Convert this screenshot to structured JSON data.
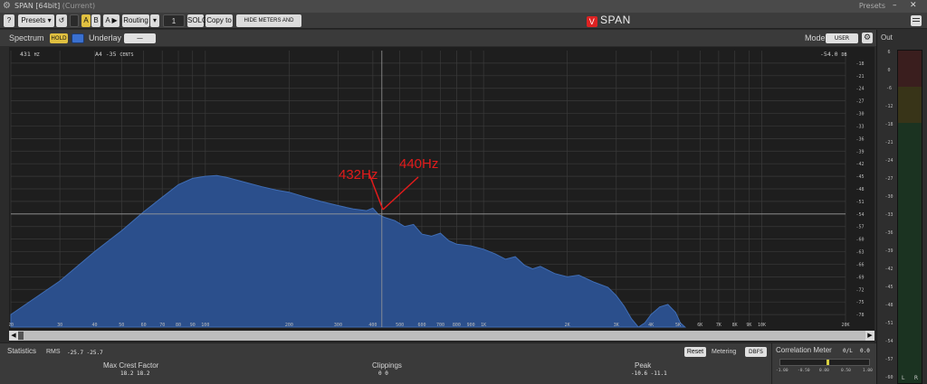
{
  "window": {
    "title": "SPAN [64bit]",
    "title_state": "(Current)",
    "presets_label": "Presets",
    "minimize": "–",
    "close": "✕"
  },
  "toolbar": {
    "help": "?",
    "presets": "Presets",
    "ab_a": "A",
    "ab_b": "B",
    "a_to_b": "A ▶ B",
    "routing": "Routing",
    "routing_value": "1",
    "solo": "SOLO",
    "copy_to": "Copy to",
    "hide_meters": "HIDE METERS AND STATS",
    "brand": "SPAN"
  },
  "spectrum_header": {
    "title": "Spectrum",
    "hold": "HOLD",
    "underlay_label": "Underlay",
    "underlay_value": "—",
    "mode_label": "Mode",
    "mode_value": "USER"
  },
  "readout": {
    "freq": "431",
    "freq_unit": "HZ",
    "note": "A4 -35",
    "note_unit": "CENTS",
    "level": "-54.0",
    "level_unit": "DB"
  },
  "annotations": [
    {
      "text": "432Hz",
      "color": "#e21b1b"
    },
    {
      "text": "440Hz",
      "color": "#e21b1b"
    }
  ],
  "colors": {
    "spectrum_fill": "#2b4f8c",
    "spectrum_edge": "#3f6db5",
    "grid": "#3a3a3a",
    "annotation": "#e21b1b",
    "hold": "#e0c040"
  },
  "chart_data": {
    "type": "area",
    "x_scale": "log",
    "xlim": [
      20,
      20000
    ],
    "ylim": [
      -81,
      -15
    ],
    "x_ticks": [
      {
        "v": 20,
        "label": "20"
      },
      {
        "v": 30,
        "label": "30"
      },
      {
        "v": 40,
        "label": "40"
      },
      {
        "v": 50,
        "label": "50"
      },
      {
        "v": 60,
        "label": "60"
      },
      {
        "v": 70,
        "label": "70"
      },
      {
        "v": 80,
        "label": "80"
      },
      {
        "v": 90,
        "label": "90"
      },
      {
        "v": 100,
        "label": "100"
      },
      {
        "v": 200,
        "label": "200"
      },
      {
        "v": 300,
        "label": "300"
      },
      {
        "v": 400,
        "label": "400"
      },
      {
        "v": 500,
        "label": "500"
      },
      {
        "v": 600,
        "label": "600"
      },
      {
        "v": 700,
        "label": "700"
      },
      {
        "v": 800,
        "label": "800"
      },
      {
        "v": 900,
        "label": "900"
      },
      {
        "v": 1000,
        "label": "1K"
      },
      {
        "v": 2000,
        "label": "2K"
      },
      {
        "v": 3000,
        "label": "3K"
      },
      {
        "v": 4000,
        "label": "4K"
      },
      {
        "v": 5000,
        "label": "5K"
      },
      {
        "v": 6000,
        "label": "6K"
      },
      {
        "v": 7000,
        "label": "7K"
      },
      {
        "v": 8000,
        "label": "8K"
      },
      {
        "v": 9000,
        "label": "9K"
      },
      {
        "v": 10000,
        "label": "10K"
      },
      {
        "v": 20000,
        "label": "20K"
      }
    ],
    "y_ticks": [
      -18,
      -21,
      -24,
      -27,
      -30,
      -33,
      -36,
      -39,
      -42,
      -45,
      -48,
      -51,
      -54,
      -57,
      -60,
      -63,
      -66,
      -69,
      -72,
      -75,
      -78
    ],
    "cursor": {
      "freq": 431,
      "level": -54.0
    },
    "points": [
      [
        20,
        -78
      ],
      [
        30,
        -70
      ],
      [
        40,
        -63
      ],
      [
        50,
        -58
      ],
      [
        60,
        -53.5
      ],
      [
        70,
        -50
      ],
      [
        80,
        -47
      ],
      [
        90,
        -45.5
      ],
      [
        100,
        -45
      ],
      [
        110,
        -44.8
      ],
      [
        120,
        -45.3
      ],
      [
        140,
        -46.5
      ],
      [
        160,
        -47.5
      ],
      [
        180,
        -48.3
      ],
      [
        200,
        -48.8
      ],
      [
        230,
        -50
      ],
      [
        260,
        -51
      ],
      [
        300,
        -52
      ],
      [
        340,
        -52.8
      ],
      [
        380,
        -53.2
      ],
      [
        400,
        -52.6
      ],
      [
        420,
        -54.2
      ],
      [
        440,
        -54.8
      ],
      [
        480,
        -55.6
      ],
      [
        520,
        -57
      ],
      [
        560,
        -56.5
      ],
      [
        600,
        -58.8
      ],
      [
        650,
        -59.3
      ],
      [
        700,
        -58.6
      ],
      [
        750,
        -60.4
      ],
      [
        800,
        -61.2
      ],
      [
        900,
        -61.6
      ],
      [
        1000,
        -62.4
      ],
      [
        1100,
        -63.5
      ],
      [
        1200,
        -64.8
      ],
      [
        1300,
        -64.2
      ],
      [
        1400,
        -66.2
      ],
      [
        1500,
        -67.1
      ],
      [
        1600,
        -66.5
      ],
      [
        1800,
        -68.2
      ],
      [
        2000,
        -69
      ],
      [
        2200,
        -68.6
      ],
      [
        2500,
        -70.3
      ],
      [
        2800,
        -71.5
      ],
      [
        3000,
        -73.5
      ],
      [
        3200,
        -76
      ],
      [
        3400,
        -79
      ],
      [
        3600,
        -81
      ],
      [
        3800,
        -80
      ],
      [
        4000,
        -78
      ],
      [
        4300,
        -76.2
      ],
      [
        4600,
        -75.6
      ],
      [
        4900,
        -77.5
      ],
      [
        5100,
        -80
      ],
      [
        5300,
        -81
      ]
    ]
  },
  "statistics": {
    "title": "Statistics",
    "rms_label": "RMS",
    "rms_values": "-25.7  -25.7",
    "max_crest_label": "Max Crest Factor",
    "max_crest_values": "18.2   18.2",
    "clippings_label": "Clippings",
    "clippings_values": "0    0",
    "peak_label": "Peak",
    "peak_values": "-10.6  -11.1",
    "reset": "Reset",
    "metering_label": "Metering",
    "metering_value": "DBFS"
  },
  "correlation": {
    "title": "Correlation Meter",
    "mode": "0/L",
    "value": "0.0",
    "value_fraction": 0.52,
    "ticks": [
      "-1.00",
      "-0.50",
      "0.00",
      "0.50",
      "1.00"
    ]
  },
  "out_meter": {
    "title": "Out",
    "scale": [
      "6",
      "0",
      "-6",
      "-12",
      "-18",
      "-21",
      "-24",
      "-27",
      "-30",
      "-33",
      "-36",
      "-39",
      "-42",
      "-45",
      "-48",
      "-51",
      "-54",
      "-57",
      "-60"
    ],
    "channel_left": "L",
    "channel_right": "R"
  }
}
